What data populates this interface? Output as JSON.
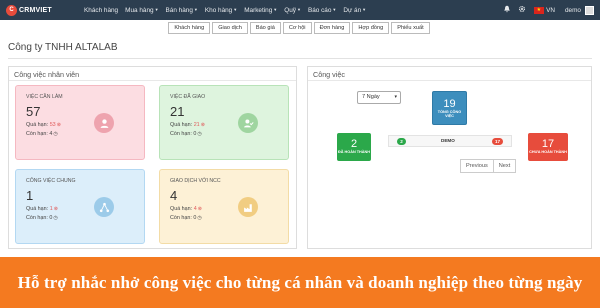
{
  "navbar": {
    "logo": "CRMVIET",
    "items": [
      "Khách hàng",
      "Mua hàng",
      "Bán hàng",
      "Kho hàng",
      "Marketing",
      "Quỹ",
      "Báo cáo",
      "Dự án"
    ],
    "language": "VN",
    "user": "demo"
  },
  "subnav": [
    "Khách hàng",
    "Giao dịch",
    "Báo giá",
    "Cơ hội",
    "Đơn hàng",
    "Hợp đồng",
    "Phiếu xuất"
  ],
  "company": "Công ty TNHH ALTALAB",
  "left_panel": {
    "title": "Công việc nhân viên",
    "cards": [
      {
        "title": "Việc cần làm",
        "count": "57",
        "overdue_label": "Quá hạn:",
        "overdue": "53",
        "remaining_label": "Còn hạn:",
        "remaining": "4",
        "icon": "user-icon"
      },
      {
        "title": "Việc đã giao",
        "count": "21",
        "overdue_label": "Quá hạn:",
        "overdue": "21",
        "remaining_label": "Còn hạn:",
        "remaining": "0",
        "icon": "user-check-icon"
      },
      {
        "title": "Công việc chung",
        "count": "1",
        "overdue_label": "Quá hạn:",
        "overdue": "1",
        "remaining_label": "Còn hạn:",
        "remaining": "0",
        "icon": "network-icon"
      },
      {
        "title": "Giao dịch với NCC",
        "count": "4",
        "overdue_label": "Quá hạn:",
        "overdue": "4",
        "remaining_label": "Còn hạn:",
        "remaining": "0",
        "icon": "factory-icon"
      }
    ]
  },
  "right_panel": {
    "title": "Công việc",
    "range_select": "7 Ngày",
    "total": {
      "value": "19",
      "label": "Tổng công việc"
    },
    "done": {
      "value": "2",
      "label": "Đã hoàn thành"
    },
    "undone": {
      "value": "17",
      "label": "Chưa hoàn thành"
    },
    "row": {
      "done": "2",
      "user": "DEMO",
      "undone": "17"
    },
    "pager": {
      "previous": "Previous",
      "next": "Next"
    }
  },
  "banner": "Hỗ trợ nhắc nhở công việc cho từng cá nhân và doanh nghiệp theo từng ngày",
  "colors": {
    "navbar": "#2c3e50",
    "banner": "#f47a20",
    "done": "#2ba84a",
    "undone": "#e74c3c",
    "total": "#3d8ebd"
  }
}
